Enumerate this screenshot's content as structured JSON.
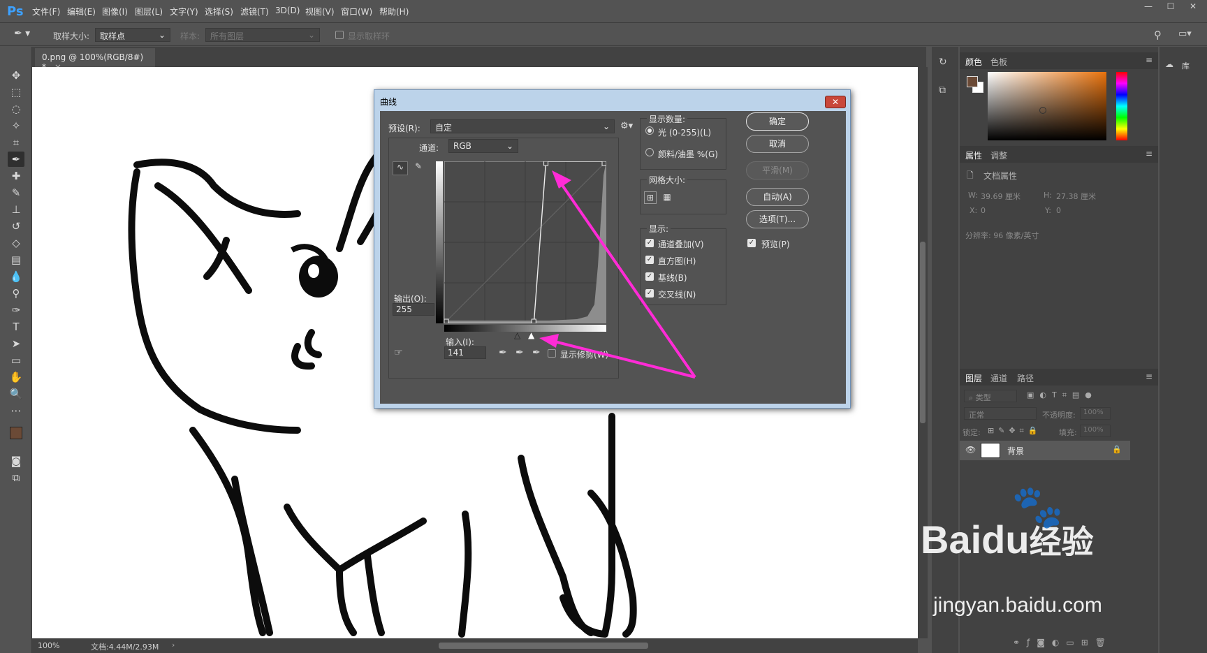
{
  "app": {
    "logo": "Ps"
  },
  "menu": [
    "文件(F)",
    "编辑(E)",
    "图像(I)",
    "图层(L)",
    "文字(Y)",
    "选择(S)",
    "滤镜(T)",
    "3D(D)",
    "视图(V)",
    "窗口(W)",
    "帮助(H)"
  ],
  "window_controls": {
    "minimize": "—",
    "maximize": "☐",
    "close": "✕"
  },
  "options": {
    "sample_size_label": "取样大小:",
    "sample_size_value": "取样点",
    "sample_label": "样本:",
    "sample_value": "所有图层",
    "show_ring": "显示取样环"
  },
  "document": {
    "tab_title": "0.png @ 100%(RGB/8#) *",
    "tab_close": "×",
    "zoom": "100%",
    "doc_info": "文档:4.44M/2.93M"
  },
  "panels": {
    "color_tabs": [
      "颜色",
      "色板"
    ],
    "props_tabs": [
      "属性",
      "调整"
    ],
    "doc_props": "文档属性",
    "w_label": "W:",
    "w_value": "39.69 厘米",
    "h_label": "H:",
    "h_value": "27.38 厘米",
    "x_label": "X:",
    "x_value": "0",
    "y_label": "Y:",
    "y_value": "0",
    "resolution": "分辨率: 96 像素/英寸",
    "layers_tabs": [
      "图层",
      "通道",
      "路径"
    ],
    "kind": "类型",
    "blend_mode": "正常",
    "opacity_label": "不透明度:",
    "opacity_value": "100%",
    "lock_label": "锁定:",
    "fill_label": "填充:",
    "fill_value": "100%",
    "layer_name": "背景",
    "library": "库"
  },
  "curves": {
    "title": "曲线",
    "close": "✕",
    "preset_label": "预设(R):",
    "preset_value": "自定",
    "channel_label": "通道:",
    "channel_value": "RGB",
    "output_label": "输出(O):",
    "output_value": "255",
    "input_label": "输入(I):",
    "input_value": "141",
    "show_clipping": "显示修剪(W)",
    "display_amount": "显示数量:",
    "light": "光 (0-255)(L)",
    "pigment": "颜料/油墨 %(G)",
    "grid_size": "网格大小:",
    "show": "显示:",
    "channel_overlay": "通道叠加(V)",
    "histogram": "直方图(H)",
    "baseline": "基线(B)",
    "intersection": "交叉线(N)",
    "ok": "确定",
    "cancel": "取消",
    "smooth": "平滑(M)",
    "auto": "自动(A)",
    "options": "选项(T)...",
    "preview": "预览(P)",
    "curve_points": [
      [
        0,
        0
      ],
      [
        141,
        0
      ],
      [
        160,
        255
      ],
      [
        255,
        255
      ]
    ]
  },
  "watermark": {
    "brand": "Bai",
    "brand2": "du",
    "cn": "经验",
    "url": "jingyan.baidu.com"
  },
  "colors": {
    "foreground": "#6b4a36",
    "accent": "#ff2bd6"
  }
}
